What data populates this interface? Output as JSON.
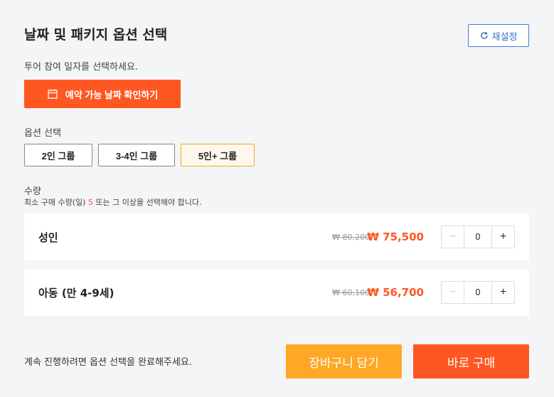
{
  "header": {
    "title": "날짜 및 패키지 옵션 선택",
    "reset_label": "재설정"
  },
  "date": {
    "subtitle": "투어 참여 일자를 선택하세요.",
    "button_label": "예약 가능 날짜 확인하기"
  },
  "options": {
    "label": "옵션 선택",
    "items": [
      {
        "label": "2인 그룹",
        "selected": false
      },
      {
        "label": "3-4인 그룹",
        "selected": false
      },
      {
        "label": "5인+ 그룹",
        "selected": true
      }
    ]
  },
  "quantity": {
    "label": "수량",
    "note_prefix": "최소 구매 수량(일) ",
    "min": "5",
    "note_suffix": " 또는 그 이상을 선택해야 합니다.",
    "rows": [
      {
        "name": "성인",
        "old_price": "₩ 80,200",
        "new_price": "₩ 75,500",
        "qty": "0",
        "minus": "−",
        "plus": "+"
      },
      {
        "name": "아동 (만 4-9세)",
        "old_price": "₩ 60,100",
        "new_price": "₩ 56,700",
        "qty": "0",
        "minus": "−",
        "plus": "+"
      }
    ]
  },
  "footer": {
    "note": "계속 진행하려면 옵션 선택을 완료해주세요.",
    "cart_label": "장바구니 담기",
    "buy_label": "바로 구매"
  },
  "colors": {
    "accent": "#ff5722",
    "secondary": "#ffa726",
    "link": "#3f7fd6"
  },
  "icons": {
    "reset": "refresh-icon",
    "date": "calendar-icon"
  }
}
